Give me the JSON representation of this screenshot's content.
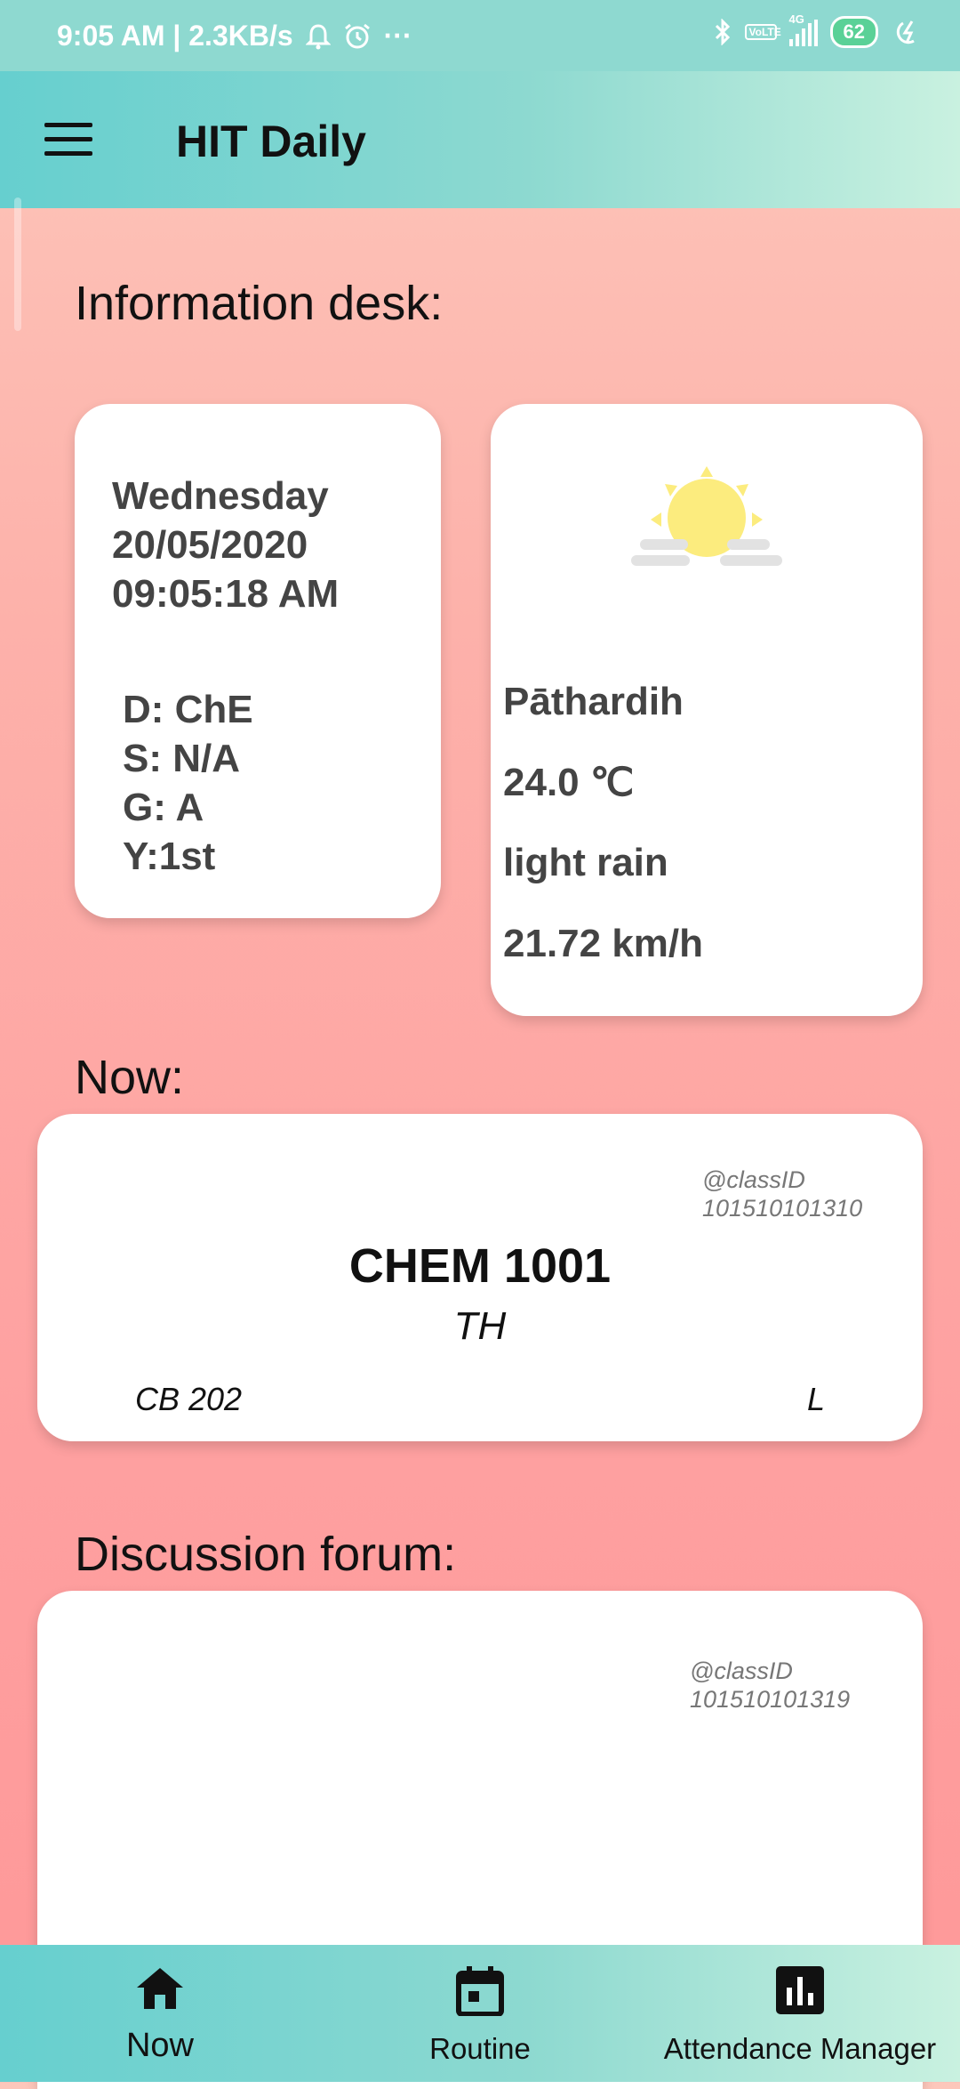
{
  "status_bar": {
    "time": "9:05 AM | 2.3KB/s",
    "more": "···",
    "battery": "62",
    "volte": "VoLTE",
    "network": "4G"
  },
  "app_bar": {
    "title": "HIT Daily"
  },
  "info_desk": {
    "heading": "Information desk:",
    "day": "Wednesday",
    "date": "20/05/2020",
    "time": "09:05:18 AM",
    "department": "D: ChE",
    "section": "S: N/A",
    "group": "G: A",
    "year": "Y:1st"
  },
  "weather": {
    "icon": "sun-icon",
    "location": "Pāthardih",
    "temperature": "24.0 ℃",
    "condition": "light rain",
    "wind": "21.72 km/h"
  },
  "now": {
    "heading": "Now:",
    "class_id_label": "@classID",
    "class_id": "101510101310",
    "course": "CHEM 1001",
    "type": "TH",
    "room": "CB 202",
    "lecture": "L"
  },
  "forum": {
    "heading": "Discussion forum:",
    "class_id_label": "@classID",
    "class_id": "101510101319"
  },
  "bottom_nav": {
    "items": [
      {
        "label": "Now",
        "icon": "home-icon",
        "active": true
      },
      {
        "label": "Routine",
        "icon": "calendar-icon",
        "active": false
      },
      {
        "label": "Attendance Manager",
        "icon": "bar-chart-icon",
        "active": false
      }
    ]
  },
  "colors": {
    "teal": "#66cfcf",
    "mint": "#c9f1e0",
    "background_top": "#fdc7bb",
    "background_bottom": "#fe9898",
    "sun": "#fcec7e"
  }
}
